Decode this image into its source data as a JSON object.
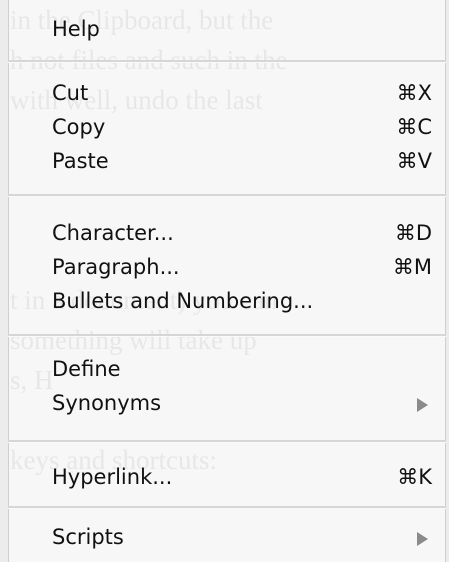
{
  "menu": {
    "help": {
      "label": "Help"
    },
    "cut": {
      "label": "Cut",
      "shortcut": "⌘X"
    },
    "copy": {
      "label": "Copy",
      "shortcut": "⌘C"
    },
    "paste": {
      "label": "Paste",
      "shortcut": "⌘V"
    },
    "character": {
      "label": "Character...",
      "shortcut": "⌘D"
    },
    "paragraph": {
      "label": "Paragraph...",
      "shortcut": "⌘M"
    },
    "bullets": {
      "label": "Bullets and Numbering..."
    },
    "define": {
      "label": "Define"
    },
    "synonyms": {
      "label": "Synonyms",
      "submenu_icon": "right-triangle"
    },
    "hyperlink": {
      "label": "Hyperlink...",
      "shortcut": "⌘K"
    },
    "scripts": {
      "label": "Scripts",
      "submenu_icon": "right-triangle"
    }
  }
}
